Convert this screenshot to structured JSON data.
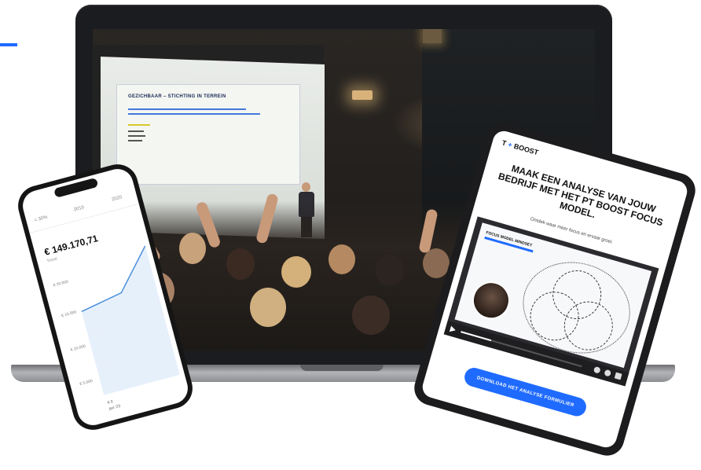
{
  "accent_color": "#1f6bff",
  "phone": {
    "tabs": [
      "< 30%",
      "2019",
      "2020"
    ],
    "value": "€ 149.170,71",
    "subtitle": "Totaal",
    "y_labels": [
      "€ 20.000",
      "€ 15.000",
      "€ 10.000",
      "€ 5.000"
    ],
    "x_label_top": "€ 0",
    "x_label_bottom": "jan '23"
  },
  "laptop": {
    "slide_title": "GEZICHBAAR – STICHTING IN TERREIN"
  },
  "tablet": {
    "logo_prefix": "T",
    "logo_plus": "+",
    "logo_text": "BOOST",
    "headline": "MAAK EEN ANALYSE VAN JOUW BEDRIJF MET HET PT BOOST FOCUS MODEL.",
    "subheadline": "Ontdek waar meer focus en ervaar groei.",
    "video_slide_title": "FOCUS MODEL MINDSET",
    "cta_label": "DOWNLOAD HET ANALYSE FORMULIER",
    "video_progress": 0.25
  }
}
